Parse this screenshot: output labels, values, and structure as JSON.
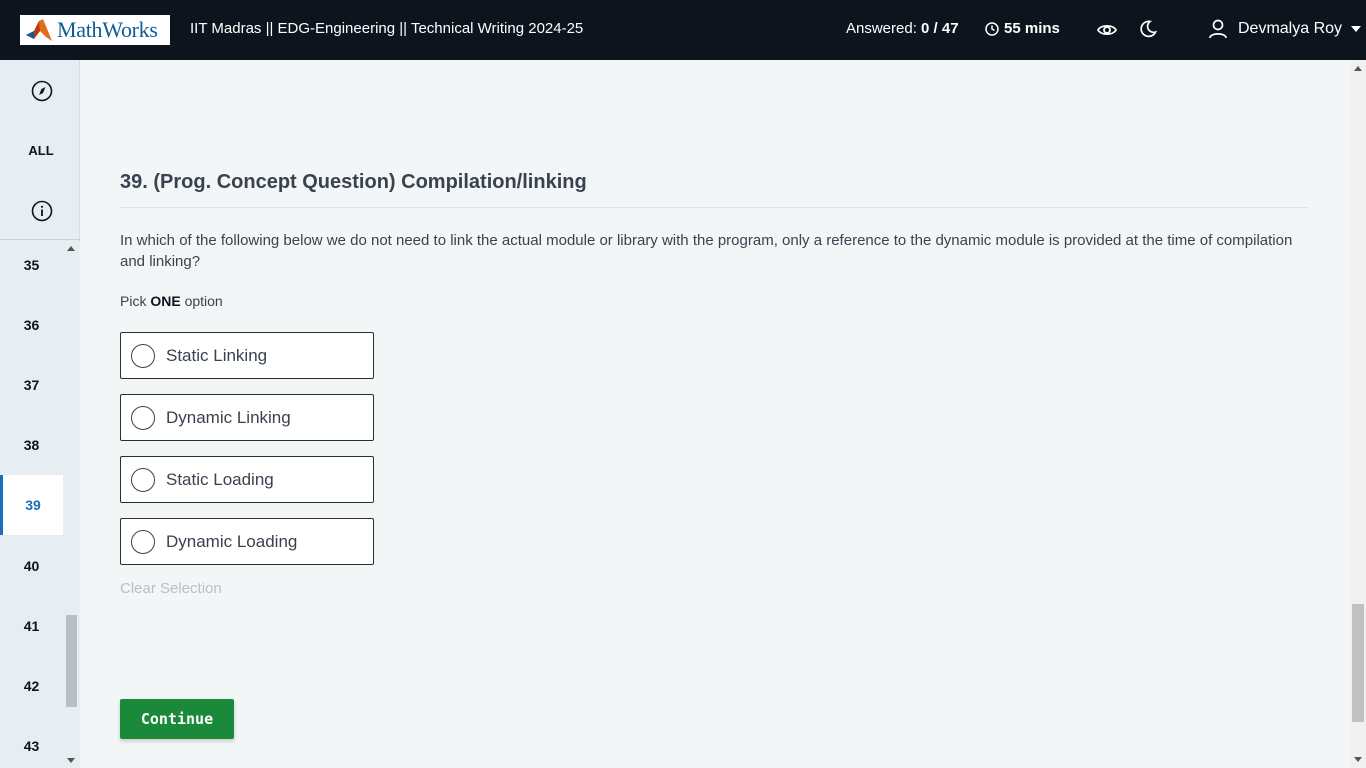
{
  "header": {
    "logo_text": "MathWorks",
    "test_title": "IIT Madras || EDG-Engineering || Technical Writing 2024-25",
    "answered_label": "Answered: ",
    "answered_value": "0 / 47",
    "timer": "55 mins",
    "user_name": "Devmalya Roy"
  },
  "sidebar": {
    "all_label": "ALL",
    "questions": [
      "35",
      "36",
      "37",
      "38",
      "39",
      "40",
      "41",
      "42",
      "43"
    ],
    "active_question": "39"
  },
  "question": {
    "title": "39. (Prog. Concept Question) Compilation/linking",
    "text": "In which of the following below we do not need to link the actual module or library with the program, only a reference to the dynamic module is provided at the time of compilation and linking?",
    "pick_prefix": "Pick ",
    "pick_bold": "ONE",
    "pick_suffix": " option",
    "options": [
      "Static Linking",
      "Dynamic Linking",
      "Static Loading",
      "Dynamic Loading"
    ],
    "clear_label": "Clear Selection",
    "continue_label": "Continue"
  },
  "colors": {
    "header_bg": "#0e141e",
    "accent_blue": "#1a6fba",
    "continue_green": "#1a8a3a",
    "page_bg": "#f3f6f7"
  },
  "icons": {
    "timer": "clock-icon",
    "eye": "eye-icon",
    "theme": "moon-icon",
    "user": "user-icon",
    "sidebar_top": "compass-icon",
    "info": "info-icon"
  }
}
